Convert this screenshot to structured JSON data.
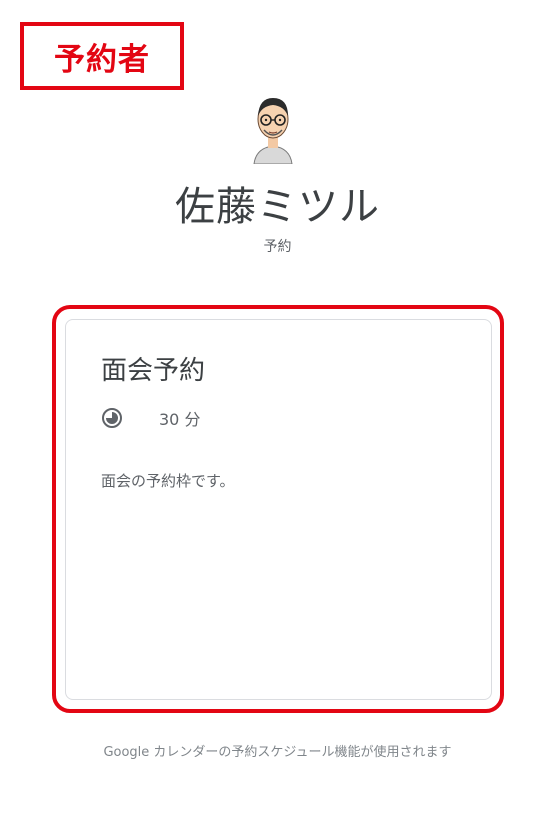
{
  "role_label": "予約者",
  "owner": {
    "name": "佐藤ミツル",
    "subtitle": "予約"
  },
  "appointment": {
    "title": "面会予約",
    "duration": "30 分",
    "description": "面会の予約枠です。"
  },
  "footer": {
    "note": "Google カレンダーの予約スケジュール機能が使用されます"
  },
  "colors": {
    "highlight": "#e30613",
    "card_border": "#dadce0",
    "text": "#3c4043"
  },
  "icons": {
    "avatar": "avatar-person-glasses",
    "duration": "clock-icon"
  }
}
